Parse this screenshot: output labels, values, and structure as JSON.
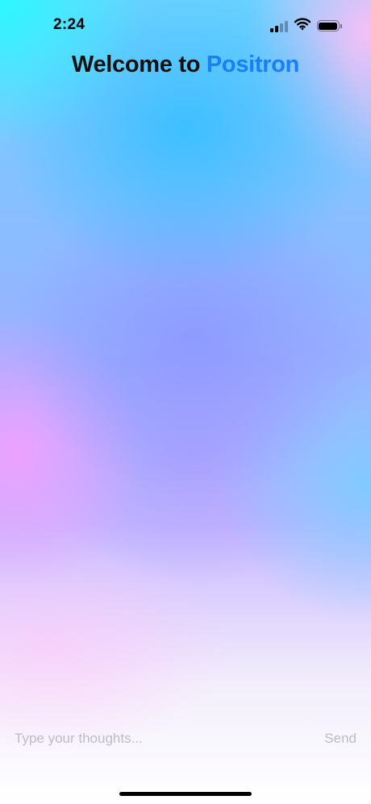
{
  "status_bar": {
    "time": "2:24",
    "icons": [
      "signal-icon",
      "wifi-icon",
      "battery-icon"
    ]
  },
  "header": {
    "title_prefix": "Welcome to ",
    "title_brand": "Positron"
  },
  "composer": {
    "input_value": "",
    "placeholder": "Type your thoughts...",
    "send_label": "Send"
  },
  "colors": {
    "brand": "#1a7ef5",
    "title_text": "#111111",
    "placeholder_text": "#bcbcc4",
    "gradient_cyan": "#28faff",
    "gradient_blue": "#32beff",
    "gradient_violet": "#8c96ff",
    "gradient_pink": "#f0a0ff"
  }
}
